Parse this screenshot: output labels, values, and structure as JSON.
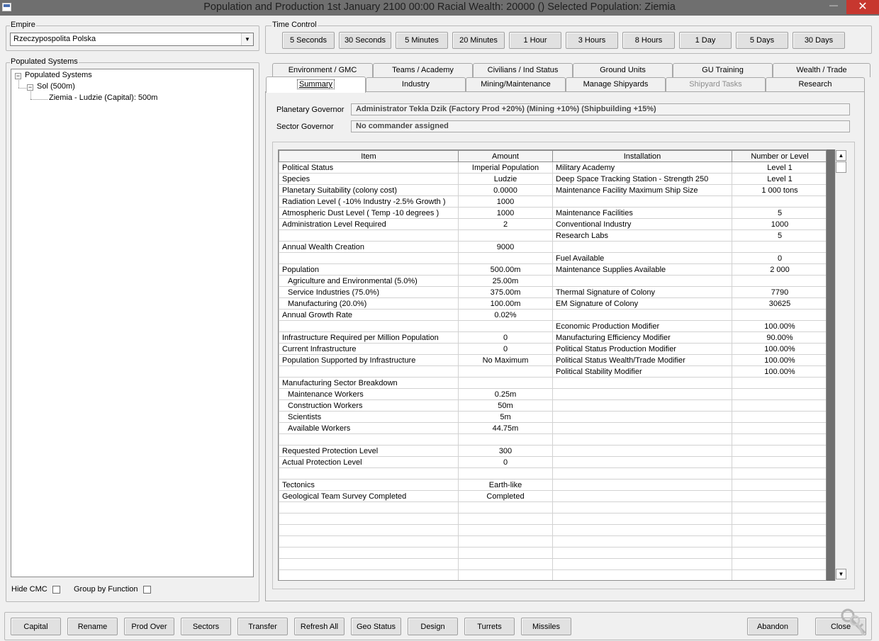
{
  "window": {
    "title": "Population and Production  1st January 2100 00:00    Racial Wealth: 20000 ()    Selected Population: Ziemia",
    "minimize_glyph": "—",
    "close_glyph": "✕"
  },
  "empire": {
    "label": "Empire",
    "selected": "Rzeczypospolita Polska"
  },
  "populated_systems": {
    "label": "Populated Systems",
    "tree": {
      "root": "Populated Systems",
      "system": "Sol (500m)",
      "planet": "Ziemia - Ludzie (Capital): 500m"
    },
    "hide_cmc_label": "Hide CMC",
    "group_by_function_label": "Group by Function"
  },
  "time_control": {
    "label": "Time Control",
    "buttons": [
      "5 Seconds",
      "30 Seconds",
      "5 Minutes",
      "20 Minutes",
      "1 Hour",
      "3 Hours",
      "8 Hours",
      "1 Day",
      "5 Days",
      "30 Days"
    ]
  },
  "tabs": {
    "row1": [
      "Environment / GMC",
      "Teams / Academy",
      "Civilians / Ind Status",
      "Ground Units",
      "GU Training",
      "Wealth / Trade"
    ],
    "row2": [
      "Summary",
      "Industry",
      "Mining/Maintenance",
      "Manage Shipyards",
      "Shipyard Tasks",
      "Research"
    ],
    "active": "Summary",
    "disabled": "Shipyard Tasks"
  },
  "governors": {
    "planetary_label": "Planetary Governor",
    "planetary_value": "Administrator Tekla Dzik   (Factory Prod +20%)  (Mining +10%)  (Shipbuilding +15%)",
    "sector_label": "Sector Governor",
    "sector_value": "No commander assigned"
  },
  "summary_table": {
    "headers": [
      "Item",
      "Amount",
      "Installation",
      "Number or Level"
    ],
    "rows": [
      {
        "item": "Political Status",
        "amount": "Imperial Population",
        "installation": "Military Academy",
        "level": "Level 1"
      },
      {
        "item": "Species",
        "amount": "Ludzie",
        "installation": "Deep Space Tracking Station - Strength 250",
        "level": "Level 1"
      },
      {
        "item": "Planetary Suitability (colony cost)",
        "amount": "0.0000",
        "installation": "Maintenance Facility Maximum Ship Size",
        "level": "1 000 tons"
      },
      {
        "item": "Radiation Level ( -10% Industry  -2.5% Growth )",
        "amount": "1000",
        "installation": "",
        "level": ""
      },
      {
        "item": "Atmospheric Dust Level ( Temp -10 degrees )",
        "amount": "1000",
        "installation": "Maintenance Facilities",
        "level": "5"
      },
      {
        "item": "Administration Level Required",
        "amount": "2",
        "installation": "Conventional Industry",
        "level": "1000"
      },
      {
        "item": "",
        "amount": "",
        "installation": "Research Labs",
        "level": "5"
      },
      {
        "item": "Annual Wealth Creation",
        "amount": "9000",
        "installation": "",
        "level": ""
      },
      {
        "item": "",
        "amount": "",
        "installation": "Fuel Available",
        "level": "0"
      },
      {
        "item": "Population",
        "amount": "500.00m",
        "installation": "Maintenance Supplies Available",
        "level": "2 000"
      },
      {
        "item": "Agriculture and Environmental  (5.0%)",
        "amount": "25.00m",
        "installation": "",
        "level": "",
        "indent": true
      },
      {
        "item": "Service Industries  (75.0%)",
        "amount": "375.00m",
        "installation": "Thermal Signature of Colony",
        "level": "7790",
        "indent": true
      },
      {
        "item": "Manufacturing  (20.0%)",
        "amount": "100.00m",
        "installation": "EM Signature of Colony",
        "level": "30625",
        "indent": true
      },
      {
        "item": "Annual Growth Rate",
        "amount": "0.02%",
        "installation": "",
        "level": ""
      },
      {
        "item": "",
        "amount": "",
        "installation": "Economic Production Modifier",
        "level": "100.00%"
      },
      {
        "item": "Infrastructure Required per Million Population",
        "amount": "0",
        "installation": "Manufacturing Efficiency Modifier",
        "level": "90.00%"
      },
      {
        "item": "Current Infrastructure",
        "amount": "0",
        "installation": "Political Status Production Modifier",
        "level": "100.00%"
      },
      {
        "item": "Population Supported by Infrastructure",
        "amount": "No Maximum",
        "installation": "Political Status Wealth/Trade Modifier",
        "level": "100.00%"
      },
      {
        "item": "",
        "amount": "",
        "installation": "Political Stability Modifier",
        "level": "100.00%"
      },
      {
        "item": "Manufacturing Sector Breakdown",
        "amount": "",
        "installation": "",
        "level": ""
      },
      {
        "item": "Maintenance Workers",
        "amount": "0.25m",
        "installation": "",
        "level": "",
        "indent": true
      },
      {
        "item": "Construction Workers",
        "amount": "50m",
        "installation": "",
        "level": "",
        "indent": true
      },
      {
        "item": "Scientists",
        "amount": "5m",
        "installation": "",
        "level": "",
        "indent": true
      },
      {
        "item": "Available Workers",
        "amount": "44.75m",
        "installation": "",
        "level": "",
        "indent": true
      },
      {
        "item": "",
        "amount": "",
        "installation": "",
        "level": ""
      },
      {
        "item": "Requested Protection Level",
        "amount": "300",
        "installation": "",
        "level": ""
      },
      {
        "item": "Actual Protection Level",
        "amount": "0",
        "installation": "",
        "level": ""
      },
      {
        "item": "",
        "amount": "",
        "installation": "",
        "level": ""
      },
      {
        "item": "Tectonics",
        "amount": "Earth-like",
        "installation": "",
        "level": ""
      },
      {
        "item": "Geological Team Survey Completed",
        "amount": "Completed",
        "installation": "",
        "level": ""
      }
    ],
    "blank_rows": 8
  },
  "bottom_buttons": [
    "Capital",
    "Rename",
    "Prod Over",
    "Sectors",
    "Transfer",
    "Refresh All",
    "Geo Status",
    "Design",
    "Turrets",
    "Missiles"
  ],
  "abandon_label": "Abandon",
  "close_label": "Close",
  "icons": {
    "app": "app-icon",
    "combo_arrow": "chevron-down-icon",
    "keys": "keys-icon"
  },
  "colors": {
    "titlebar": "#6f6f6f",
    "close_button": "#c7372f",
    "window_bg": "#f0f0f0"
  }
}
